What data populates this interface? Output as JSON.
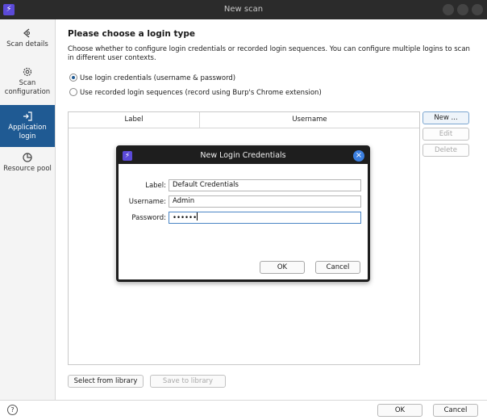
{
  "window": {
    "title": "New scan"
  },
  "sidebar": {
    "items": [
      {
        "label": "Scan details",
        "icon": "target-icon"
      },
      {
        "label": "Scan configuration",
        "icon": "gear-icon"
      },
      {
        "label": "Application login",
        "icon": "login-arrow-icon",
        "active": true
      },
      {
        "label": "Resource pool",
        "icon": "pie-chart-icon"
      }
    ]
  },
  "main": {
    "heading": "Please choose a login type",
    "description": "Choose whether to configure login credentials or recorded login sequences. You can configure multiple logins to scan in different user contexts.",
    "options": [
      {
        "label": "Use login credentials (username & password)",
        "selected": true
      },
      {
        "label": "Use recorded login sequences (record using Burp's Chrome extension)",
        "selected": false
      }
    ],
    "table": {
      "columns": [
        "Label",
        "Username"
      ]
    },
    "buttons": {
      "new": "New ...",
      "edit": "Edit",
      "delete": "Delete"
    },
    "library": {
      "select": "Select from library",
      "save": "Save to library"
    }
  },
  "footer": {
    "help": "?",
    "ok": "OK",
    "cancel": "Cancel"
  },
  "dialog": {
    "title": "New Login Credentials",
    "close": "×",
    "fields": {
      "label": {
        "name": "Label:",
        "value": "Default Credentials"
      },
      "username": {
        "name": "Username:",
        "value": "Admin"
      },
      "password": {
        "name": "Password:",
        "value": "••••••"
      }
    },
    "ok": "OK",
    "cancel": "Cancel"
  },
  "colors": {
    "accent": "#1f5a93",
    "app_icon": "#5b4ad8",
    "close_button": "#3b7fe0"
  }
}
